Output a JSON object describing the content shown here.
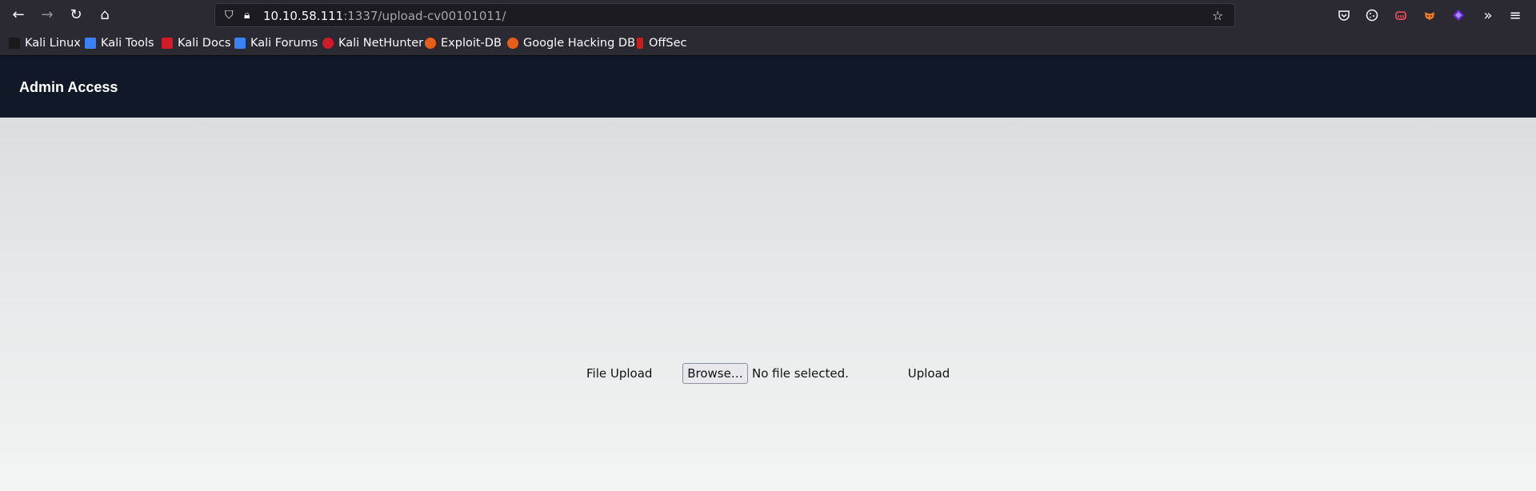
{
  "browser": {
    "url_host": "10.10.58.111",
    "url_path": ":1337/upload-cv00101011/",
    "icons": {
      "back": "back-arrow-icon",
      "forward": "forward-arrow-icon",
      "reload": "reload-icon",
      "home": "home-icon",
      "shield": "shield-icon",
      "lock": "lock-icon",
      "star": "bookmark-star-icon",
      "pocket": "pocket-icon",
      "cookie": "cookie-icon",
      "ext1": "extension-red-icon",
      "ext2": "extension-fox-icon",
      "ext3": "extension-purple-icon",
      "overflow": "chevron-overflow-icon",
      "menu": "hamburger-menu-icon"
    }
  },
  "bookmarks": [
    {
      "label": "Kali Linux",
      "color": "#1a1a1a"
    },
    {
      "label": "Kali Tools",
      "color": "#3b82f6"
    },
    {
      "label": "Kali Docs",
      "color": "#d11a2a"
    },
    {
      "label": "Kali Forums",
      "color": "#3b82f6"
    },
    {
      "label": "Kali NetHunter",
      "color": "#d11a2a"
    },
    {
      "label": "Exploit-DB",
      "color": "#e85d1a"
    },
    {
      "label": "Google Hacking DB",
      "color": "#e85d1a"
    },
    {
      "label": "OffSec",
      "color": "#c81e1e"
    }
  ],
  "site": {
    "brand": "Admin Access",
    "header_color": "#111827"
  },
  "upload": {
    "label": "File Upload",
    "browse_label": "Browse…",
    "file_status": "No file selected.",
    "submit_label": "Upload"
  }
}
